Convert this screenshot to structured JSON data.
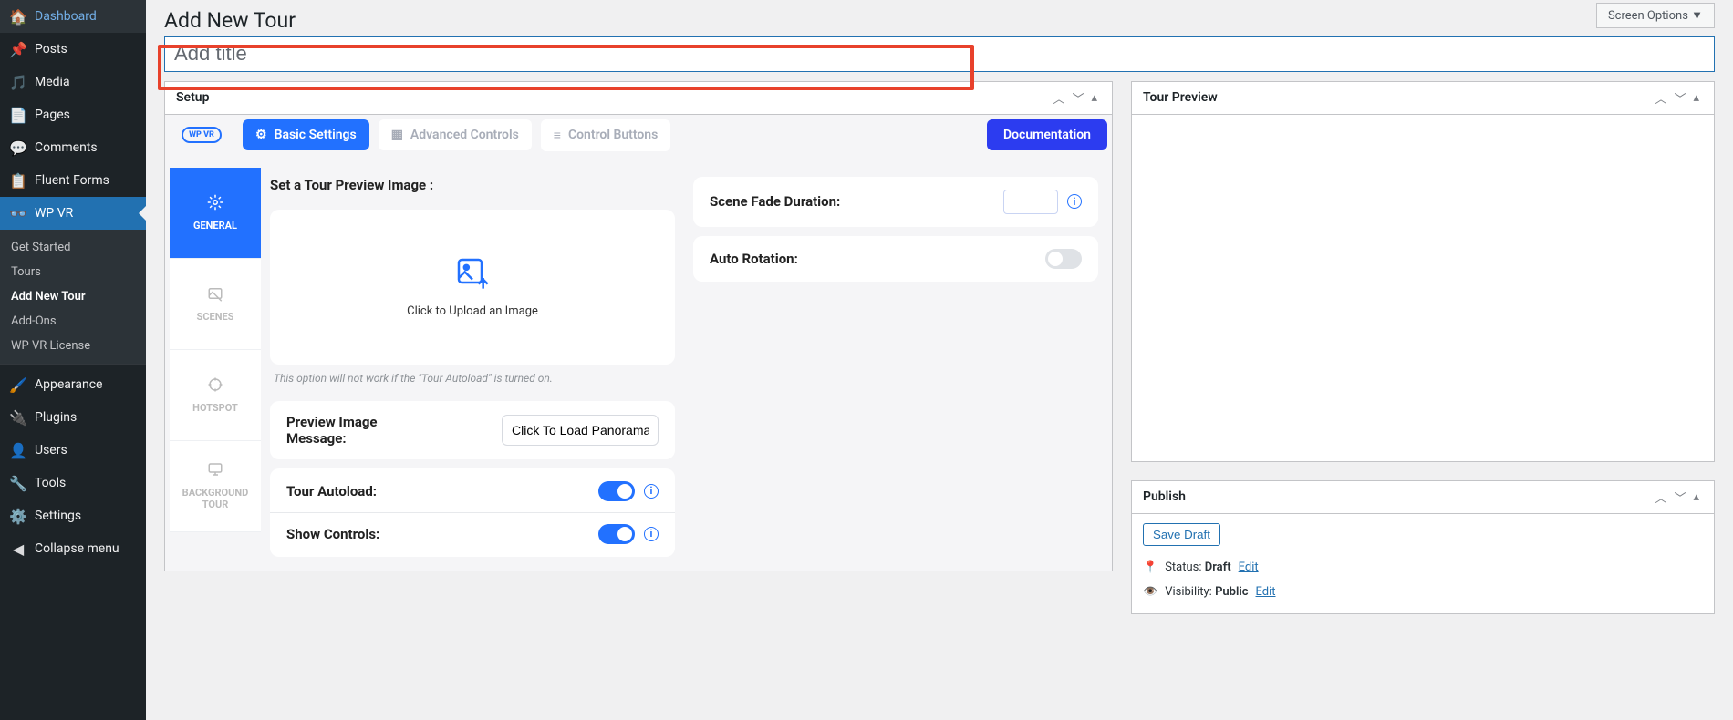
{
  "screen_options": "Screen Options  ▼",
  "page_title": "Add New Tour",
  "title_placeholder": "Add title",
  "sidebar": [
    {
      "label": "Dashboard",
      "icon": "dashboard"
    },
    {
      "label": "Posts",
      "icon": "pin"
    },
    {
      "label": "Media",
      "icon": "media"
    },
    {
      "label": "Pages",
      "icon": "pages"
    },
    {
      "label": "Comments",
      "icon": "comment"
    },
    {
      "label": "Fluent Forms",
      "icon": "form"
    },
    {
      "label": "WP VR",
      "icon": "wpvr",
      "active": true
    }
  ],
  "wpvr_sub": [
    {
      "label": "Get Started"
    },
    {
      "label": "Tours"
    },
    {
      "label": "Add New Tour",
      "active": true
    },
    {
      "label": "Add-Ons"
    },
    {
      "label": "WP VR License"
    }
  ],
  "sidebar_bottom": [
    {
      "label": "Appearance",
      "icon": "brush"
    },
    {
      "label": "Plugins",
      "icon": "plug"
    },
    {
      "label": "Users",
      "icon": "user"
    },
    {
      "label": "Tools",
      "icon": "wrench"
    },
    {
      "label": "Settings",
      "icon": "settings"
    },
    {
      "label": "Collapse menu",
      "icon": "collapse"
    }
  ],
  "setup": {
    "title": "Setup",
    "logo": "WP VR",
    "htabs": {
      "basic": "Basic Settings",
      "advanced": "Advanced Controls",
      "control": "Control Buttons"
    },
    "doc_btn": "Documentation",
    "vtabs": {
      "general": "GENERAL",
      "scenes": "SCENES",
      "hotspot": "HOTSPOT",
      "background": "BACKGROUND TOUR"
    },
    "preview_label": "Set a Tour Preview Image :",
    "upload_text": "Click to Upload an Image",
    "note": "This option will not work if the \"Tour Autoload\" is turned on.",
    "preview_msg_label": "Preview Image Message:",
    "preview_msg_value": "Click To Load Panorama",
    "autoload_label": "Tour Autoload:",
    "show_controls_label": "Show Controls:",
    "fade_label": "Scene Fade Duration:",
    "rotation_label": "Auto Rotation:"
  },
  "preview": {
    "title": "Tour Preview"
  },
  "publish": {
    "title": "Publish",
    "save_draft": "Save Draft",
    "status_prefix": "Status: ",
    "status_value": "Draft",
    "visibility_prefix": "Visibility: ",
    "visibility_value": "Public",
    "edit": "Edit"
  }
}
